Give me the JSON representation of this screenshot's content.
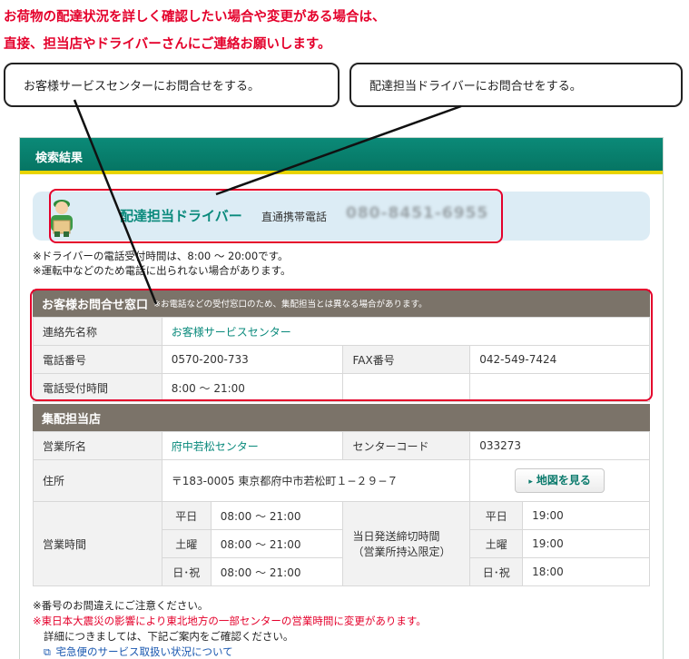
{
  "intro": {
    "line1": "お荷物の配達状況を詳しく確認したい場合や変更がある場合は、",
    "line2": "直接、担当店やドライバーさんにご連絡お願いします。"
  },
  "callouts": {
    "customer_center": "お客様サービスセンターにお問合せをする。",
    "driver": "配達担当ドライバーにお問合せをする。"
  },
  "panel": {
    "title": "検索結果"
  },
  "driver": {
    "title": "配達担当ドライバー",
    "phone_label": "直通携帯電話",
    "phone": "080-8451-6955",
    "note1": "※ドライバーの電話受付時間は、8:00 〜 20:00です。",
    "note2": "※運転中などのため電話に出られない場合があります。"
  },
  "customer_window": {
    "heading": "お客様お問合せ窓口",
    "heading_note": "※お電話などの受付窓口のため、集配担当とは異なる場合があります。",
    "rows": {
      "name_label": "連絡先名称",
      "name_value": "お客様サービスセンター",
      "tel_label": "電話番号",
      "tel_value": "0570-200-733",
      "fax_label": "FAX番号",
      "fax_value": "042-549-7424",
      "hours_label": "電話受付時間",
      "hours_value": "8:00 〜 21:00"
    }
  },
  "branch": {
    "heading": "集配担当店",
    "office_label": "営業所名",
    "office_value": "府中若松センター",
    "center_code_label": "センターコード",
    "center_code_value": "033273",
    "address_label": "住所",
    "address_value": "〒183-0005 東京都府中市若松町１−２９−７",
    "map_button": "地図を見る",
    "hours_label": "営業時間",
    "cutoff_label_1": "当日発送締切時間",
    "cutoff_label_2": "（営業所持込限定）",
    "days": [
      {
        "day": "平日",
        "hours": "08:00  〜  21:00",
        "cutoff": "19:00"
      },
      {
        "day": "土曜",
        "hours": "08:00  〜  21:00",
        "cutoff": "19:00"
      },
      {
        "day": "日･祝",
        "hours": "08:00  〜  21:00",
        "cutoff": "18:00"
      }
    ]
  },
  "footer": {
    "note1": "※番号のお間違えにご注意ください。",
    "note2": "※東日本大震災の影響により東北地方の一部センターの営業時間に変更があります。",
    "note3": "詳細につきましては、下記ご案内をご確認ください。",
    "link": "宅急便のサービス取扱い状況について"
  },
  "colors": {
    "accent_red": "#e4002b",
    "header_green": "#0b8a78",
    "section_brown": "#7b7369",
    "link_teal": "#0a8a7c"
  }
}
